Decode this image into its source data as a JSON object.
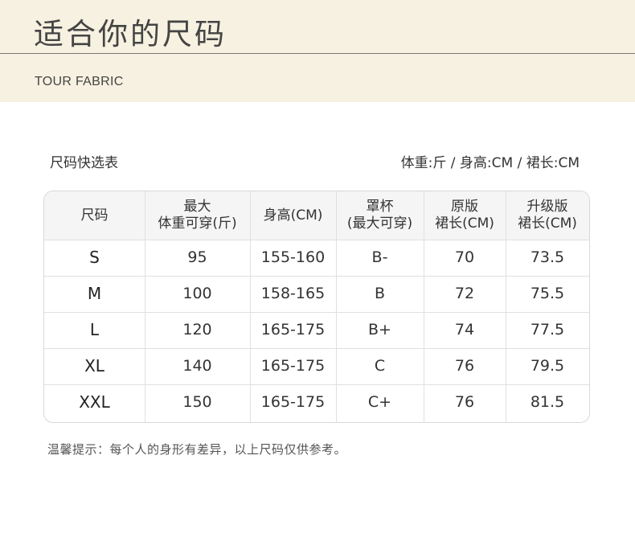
{
  "banner": {
    "title": "适合你的尺码",
    "subtitle": "TOUR FABRIC"
  },
  "selector": {
    "title": "尺码快选表",
    "units": "体重:斤 / 身高:CM / 裙长:CM"
  },
  "table": {
    "headers": [
      {
        "line1": "尺码",
        "line2": ""
      },
      {
        "line1": "最大",
        "line2": "体重可穿(斤)"
      },
      {
        "line1": "身高(CM)",
        "line2": ""
      },
      {
        "line1": "罩杯",
        "line2": "(最大可穿)"
      },
      {
        "line1": "原版",
        "line2": "裙长(CM)"
      },
      {
        "line1": "升级版",
        "line2": "裙长(CM)"
      }
    ],
    "rows": [
      [
        "S",
        "95",
        "155-160",
        "B-",
        "70",
        "73.5"
      ],
      [
        "M",
        "100",
        "158-165",
        "B",
        "72",
        "75.5"
      ],
      [
        "L",
        "120",
        "165-175",
        "B+",
        "74",
        "77.5"
      ],
      [
        "XL",
        "140",
        "165-175",
        "C",
        "76",
        "79.5"
      ],
      [
        "XXL",
        "150",
        "165-175",
        "C+",
        "76",
        "81.5"
      ]
    ]
  },
  "note": "温馨提示：每个人的身形有差异，以上尺码仅供参考。",
  "colors": {
    "banner_bg": "#f6f1e0",
    "header_bg": "#f5f5f5",
    "border": "#d9d9d9"
  }
}
